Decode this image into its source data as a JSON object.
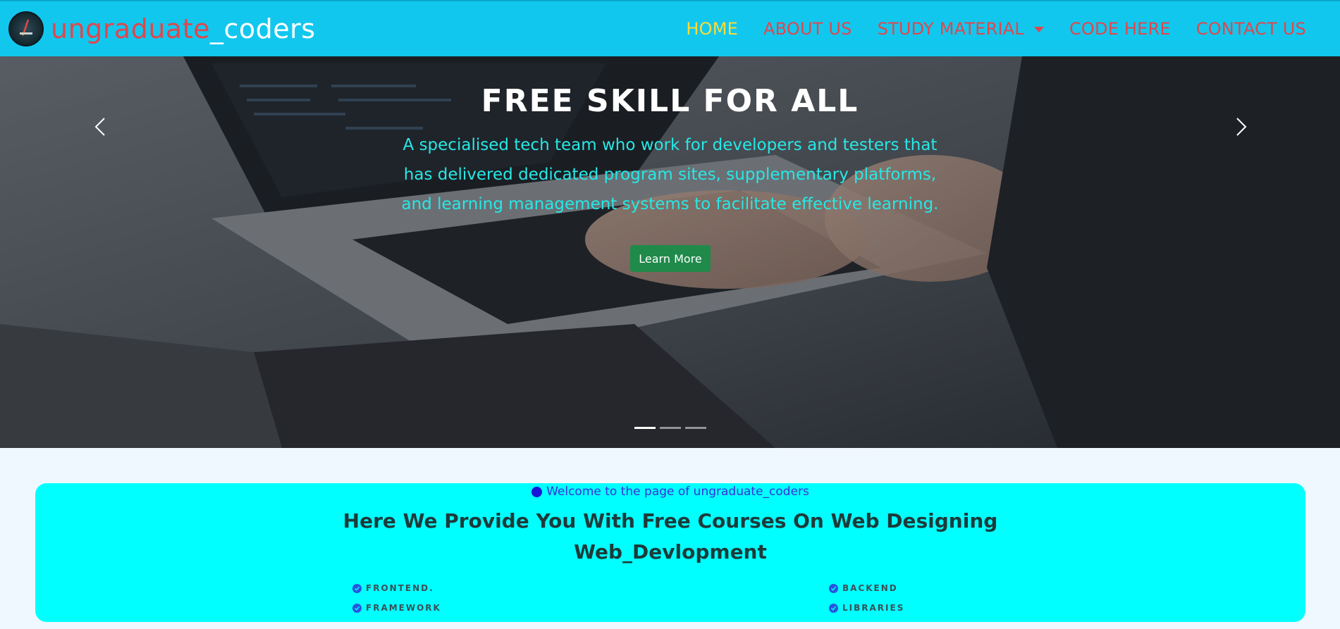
{
  "brand": {
    "name_red": "ungraduate",
    "name_white": "_coders",
    "logo_icon": "brand-logo-icon"
  },
  "nav": {
    "items": [
      {
        "label": "HOME",
        "active": true
      },
      {
        "label": "ABOUT US",
        "active": false
      },
      {
        "label": "STUDY MATERIAL",
        "active": false,
        "dropdown": true
      },
      {
        "label": "CODE HERE",
        "active": false
      },
      {
        "label": "CONTACT US",
        "active": false
      }
    ]
  },
  "hero": {
    "title": "FREE SKILL FOR ALL",
    "text": "A specialised tech team who work for developers and testers that has delivered dedicated program sites, supplementary platforms, and learning management systems to facilitate effective learning.",
    "button": "Learn More",
    "slides": 3,
    "active_slide": 1,
    "prev_icon": "chevron-left-icon",
    "next_icon": "chevron-right-icon"
  },
  "welcome": {
    "tagline": "Welcome to the page of ungraduate_coders",
    "headline_line1": "Here We Provide You With Free Courses On Web Designing",
    "headline_line2": "Web_Devlopment",
    "features": [
      "FRONTEND.",
      "BACKEND",
      "FRAMEWORK",
      "LIBRARIES"
    ]
  },
  "colors": {
    "navbar": "#12c7ee",
    "nav_link": "#e0474c",
    "nav_active": "#f7dc3b",
    "hero_text": "#27e8e6",
    "button": "#1f8a4a",
    "card": "#00ffff"
  }
}
